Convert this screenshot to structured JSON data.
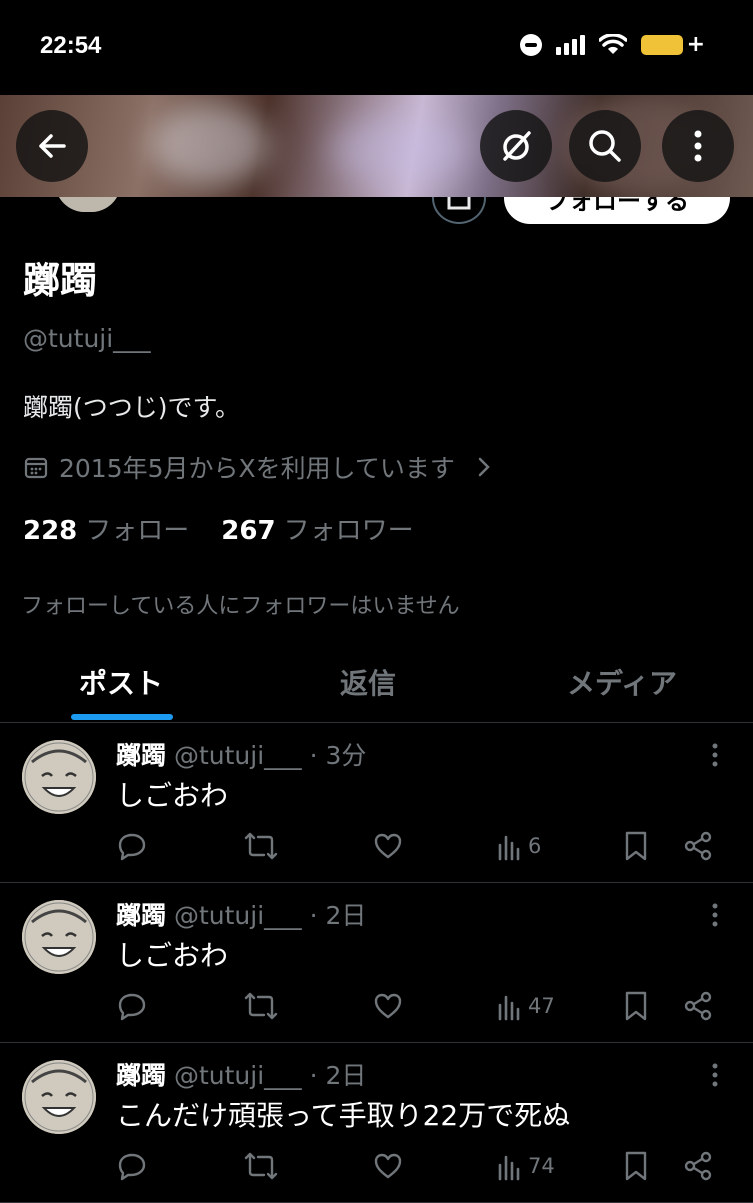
{
  "status": {
    "time": "22:54"
  },
  "profile": {
    "name": "躑躅",
    "handle": "@tutuji___",
    "bio": "躑躅(つつじ)です。",
    "joined": "2015年5月からXを利用しています",
    "following_count": "228",
    "following_label": "フォロー",
    "followers_count": "267",
    "followers_label": "フォロワー",
    "known_followers": "フォローしている人にフォロワーはいません",
    "follow_button": "フォローする"
  },
  "tabs": [
    {
      "label": "ポスト",
      "active": true
    },
    {
      "label": "返信",
      "active": false
    },
    {
      "label": "メディア",
      "active": false
    }
  ],
  "posts": [
    {
      "name": "躑躅",
      "handle": "@tutuji___",
      "time": "3分",
      "text": "しごおわ",
      "views": "6"
    },
    {
      "name": "躑躅",
      "handle": "@tutuji___",
      "time": "2日",
      "text": "しごおわ",
      "views": "47"
    },
    {
      "name": "躑躅",
      "handle": "@tutuji___",
      "time": "2日",
      "text": "こんだけ頑張って手取り22万で死ぬ",
      "views": "74"
    }
  ],
  "icons": {
    "back": "arrow-left-icon",
    "grok": "grok-icon",
    "search": "search-icon",
    "more": "more-vertical-icon",
    "calendar": "calendar-icon",
    "chevron": "chevron-right-icon",
    "reply": "reply-icon",
    "repost": "repost-icon",
    "like": "heart-icon",
    "views": "views-icon",
    "bookmark": "bookmark-icon",
    "share": "share-icon"
  },
  "colors": {
    "accent": "#1d9bf0",
    "muted": "#71767b",
    "battery": "#f0c238"
  }
}
